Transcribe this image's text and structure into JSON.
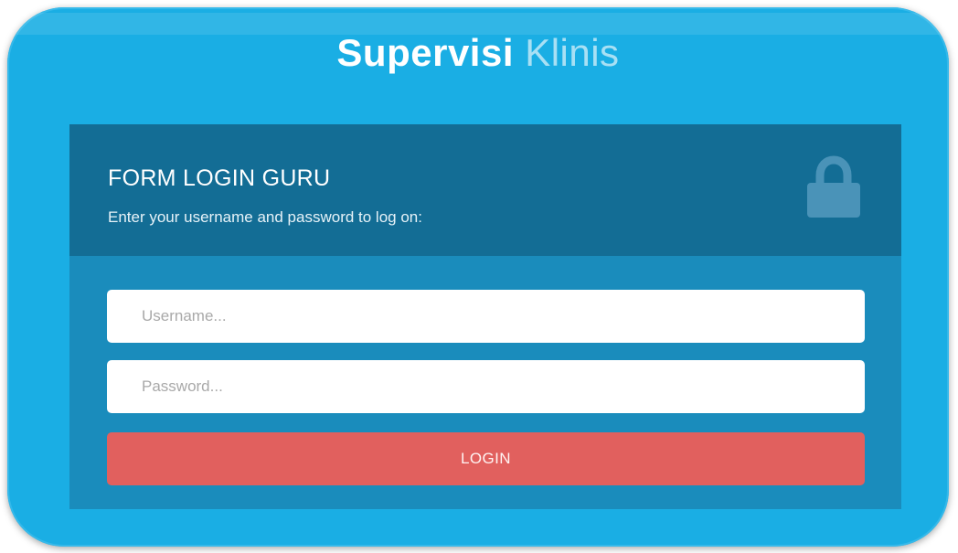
{
  "header": {
    "title_strong": "Supervisi",
    "title_light": "Klinis"
  },
  "login_form": {
    "title": "FORM LOGIN GURU",
    "subtitle": "Enter your username and password to log on:",
    "lock_icon": "lock-icon",
    "username": {
      "placeholder": "Username...",
      "value": ""
    },
    "password": {
      "placeholder": "Password...",
      "value": ""
    },
    "login_button_label": "LOGIN"
  },
  "colors": {
    "frame_background": "#1aaee4",
    "panel_header": "#136d95",
    "panel_body": "#1a8cbc",
    "login_button": "#e1605e"
  }
}
